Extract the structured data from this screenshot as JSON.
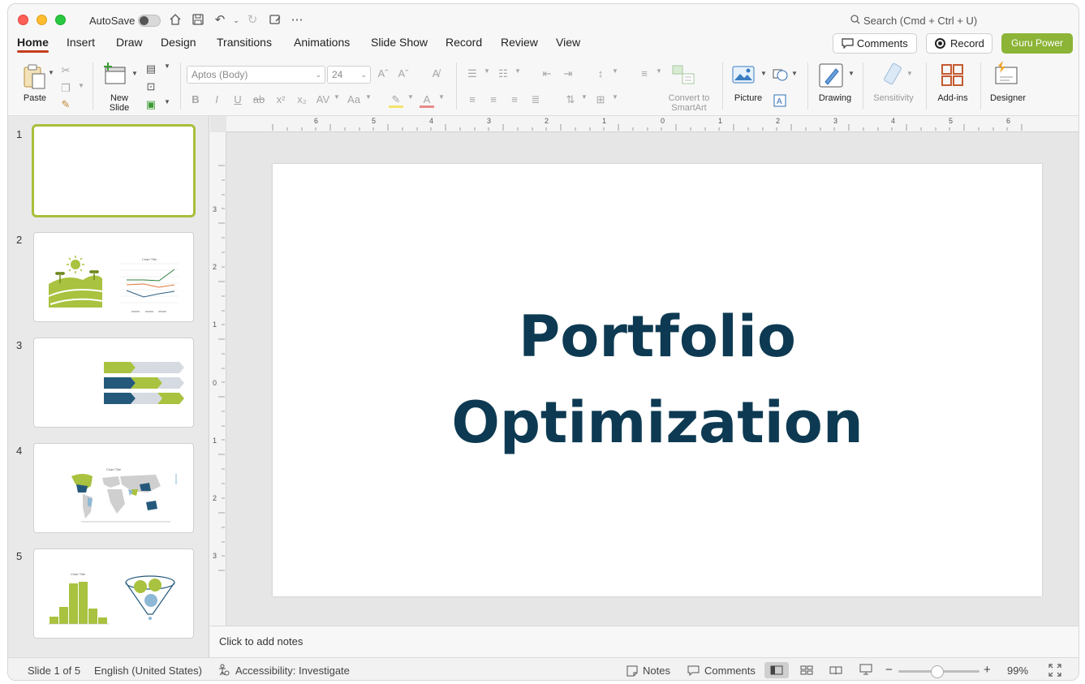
{
  "titlebar": {
    "autosave_label": "AutoSave",
    "search_placeholder": "Search (Cmd + Ctrl + U)"
  },
  "tabs": [
    "Home",
    "Insert",
    "Draw",
    "Design",
    "Transitions",
    "Animations",
    "Slide Show",
    "Record",
    "Review",
    "View"
  ],
  "actions": {
    "comments": "Comments",
    "record": "Record",
    "guru": "Guru Power"
  },
  "ribbon": {
    "paste": "Paste",
    "new_slide_1": "New",
    "new_slide_2": "Slide",
    "font_name": "Aptos (Body)",
    "font_size": "24",
    "convert_1": "Convert to",
    "convert_2": "SmartArt",
    "picture": "Picture",
    "drawing": "Drawing",
    "sensitivity": "Sensitivity",
    "addins": "Add-ins",
    "designer": "Designer"
  },
  "thumbnails": {
    "numbers": [
      "1",
      "2",
      "3",
      "4",
      "5"
    ],
    "chart_title": "Chart Title"
  },
  "ruler": {
    "h_labels": [
      "6",
      "5",
      "4",
      "3",
      "2",
      "1",
      "0",
      "1",
      "2",
      "3",
      "4",
      "5",
      "6"
    ],
    "v_labels": [
      "3",
      "2",
      "1",
      "0",
      "1",
      "2",
      "3"
    ]
  },
  "slide": {
    "title_line1": "Portfolio",
    "title_line2": "Optimization"
  },
  "notes": {
    "placeholder": "Click to add notes"
  },
  "status": {
    "slide_counter": "Slide 1 of 5",
    "language": "English (United States)",
    "accessibility": "Accessibility: Investigate",
    "notes": "Notes",
    "comments": "Comments",
    "zoom_level": "99%"
  },
  "colors": {
    "accent_green": "#8cb437",
    "title_navy": "#0d3a52",
    "tab_underline": "#c43e1c"
  }
}
